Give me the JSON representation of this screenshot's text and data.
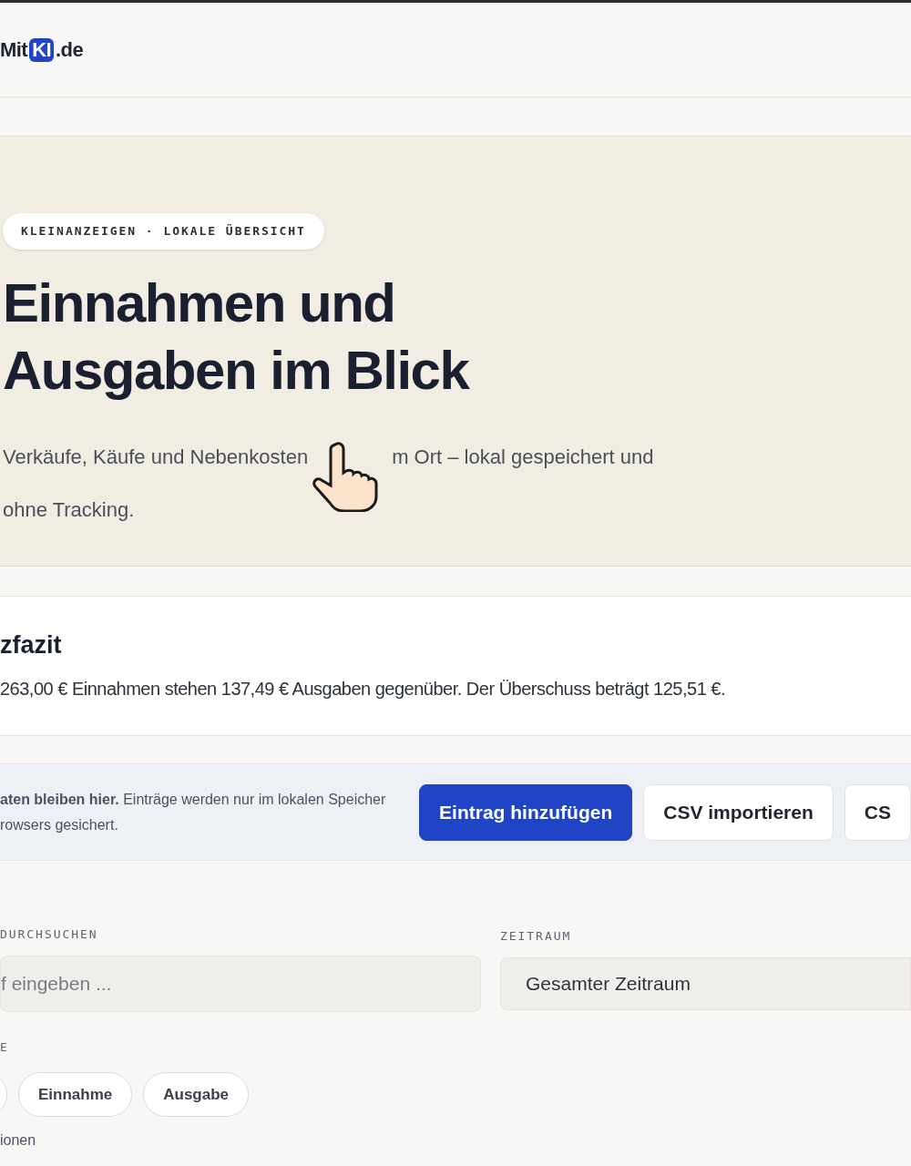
{
  "header": {
    "logo": {
      "before": "Mit",
      "badge": "KI",
      "after": ".de"
    }
  },
  "hero": {
    "eyebrow": "KLEINANZEIGEN · LOKALE ÜBERSICHT",
    "title_lines": [
      "Einnahmen und",
      "Ausgaben im Blick"
    ],
    "intro_before_cursor": "Verkäufe, Käufe und Nebenkosten",
    "intro_after_cursor": "m Ort – lokal gespeichert und",
    "intro_line_2": "ohne Tracking."
  },
  "summary": {
    "title": "zfazit",
    "text": "263,00 € Einnahmen stehen 137,49 € Ausgaben gegenüber. Der Überschuss beträgt 125,51 €."
  },
  "storage_note": {
    "lines": [
      "**aten bleiben hier.** Einträge werden nur im lokalen Speicher",
      "rowsers gesichert."
    ]
  },
  "actions": [
    {
      "label": "Eintrag hinzufügen",
      "kind": "primary"
    },
    {
      "label": "CSV importieren",
      "kind": "secondary"
    },
    {
      "label": "CS",
      "kind": "secondary"
    }
  ],
  "filters": {
    "search": {
      "label": "DURCHSUCHEN",
      "placeholder": "f eingeben ..."
    },
    "period": {
      "label": "ZEITRAUM",
      "value": "Gesamter Zeitraum"
    },
    "type_label": "E",
    "type_chips": [
      {
        "selected": false
      },
      {
        "label": "Einnahme",
        "selected": false
      },
      {
        "label": "Ausgabe",
        "selected": false
      }
    ],
    "next_label": "ionen"
  }
}
